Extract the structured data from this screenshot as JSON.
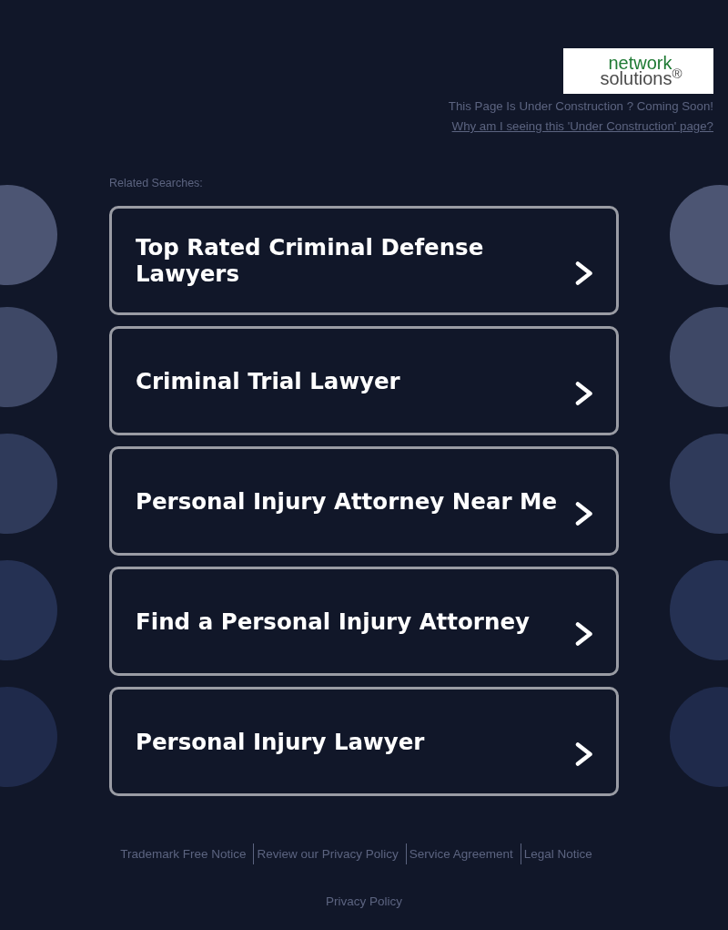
{
  "header": {
    "logo": {
      "line_1": "network",
      "line_2": "solutions$^{®}$"
    },
    "notice": "This Page Is Under Construction ? Coming Soon!",
    "link": "Why am I seeing this 'Under Construction' page?"
  },
  "related_searches": {
    "heading": "Related Searches:",
    "items": [
      "Top Rated Criminal Defense Lawyers",
      "Criminal Trial Lawyer",
      "Personal Injury Attorney Near Me",
      "Find a Personal Injury Attorney",
      "Personal Injury Lawyer"
    ]
  },
  "footer": {
    "links": [
      "Trademark Free Notice",
      "Review our Privacy Policy",
      "Service Agreement",
      "Legal Notice"
    ],
    "privacy_policy": "Privacy Policy"
  }
}
